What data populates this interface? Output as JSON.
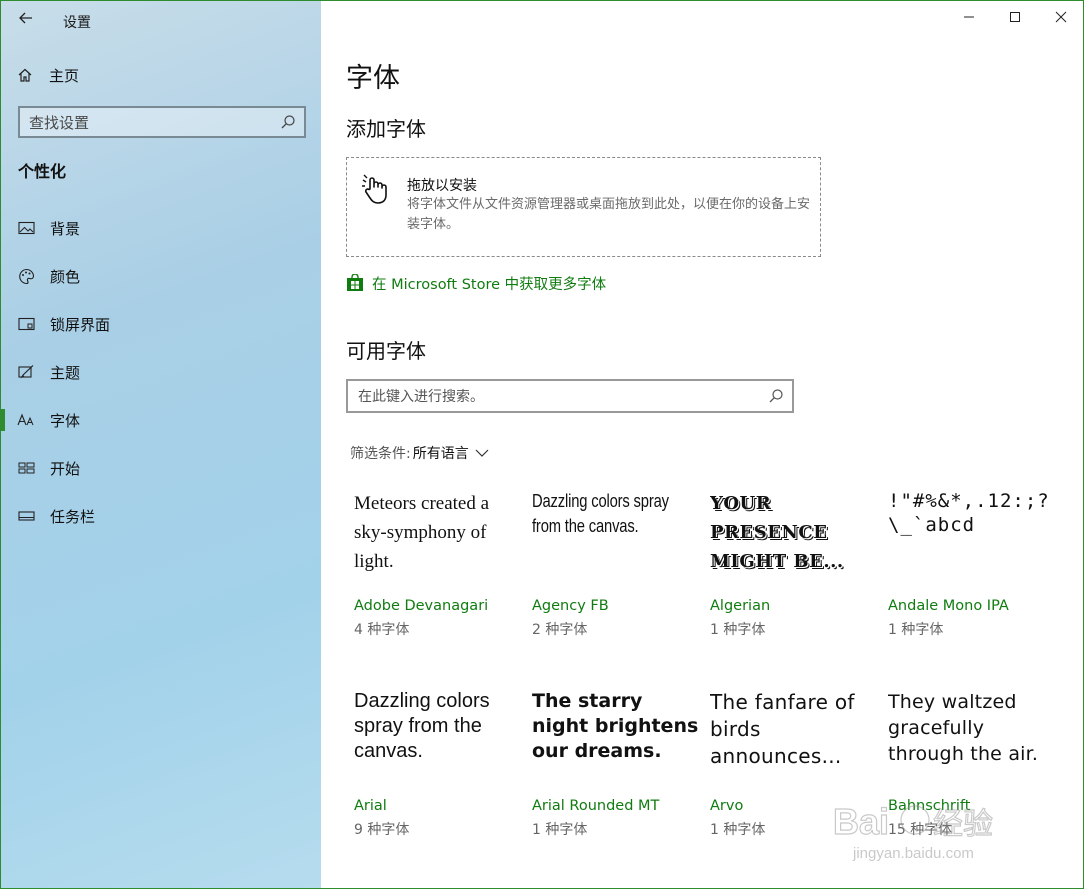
{
  "window": {
    "title": "设置"
  },
  "sidebar": {
    "home_label": "主页",
    "search_placeholder": "查找设置",
    "section_title": "个性化",
    "items": [
      {
        "label": "背景",
        "icon": "picture-icon"
      },
      {
        "label": "颜色",
        "icon": "palette-icon"
      },
      {
        "label": "锁屏界面",
        "icon": "lock-screen-icon"
      },
      {
        "label": "主题",
        "icon": "theme-brush-icon"
      },
      {
        "label": "字体",
        "icon": "font-icon",
        "active": true
      },
      {
        "label": "开始",
        "icon": "start-icon"
      },
      {
        "label": "任务栏",
        "icon": "taskbar-icon"
      }
    ]
  },
  "main": {
    "page_title": "字体",
    "add_heading": "添加字体",
    "drop_zone": {
      "title": "拖放以安装",
      "description": "将字体文件从文件资源管理器或桌面拖放到此处，以便在你的设备上安装字体。"
    },
    "store_link": "在 Microsoft Store 中获取更多字体",
    "available_heading": "可用字体",
    "search_placeholder": "在此键入进行搜索。",
    "filter_label": "筛选条件:",
    "filter_value": "所有语言",
    "fonts": [
      {
        "preview": "Meteors created a sky-symphony of light.",
        "name": "Adobe Devanagari",
        "count": "4 种字体"
      },
      {
        "preview": "Dazzling colors spray from the canvas.",
        "name": "Agency FB",
        "count": "2 种字体"
      },
      {
        "preview": "YOUR PRESENCE MIGHT BE...",
        "name": "Algerian",
        "count": "1 种字体"
      },
      {
        "preview": "!\"#%&*,.12:;?\\_`abcd",
        "name": "Andale Mono IPA",
        "count": "1 种字体"
      },
      {
        "preview": "Dazzling colors spray from the canvas.",
        "name": "Arial",
        "count": "9 种字体"
      },
      {
        "preview": "The starry night brightens our dreams.",
        "name": "Arial Rounded MT",
        "count": "1 种字体"
      },
      {
        "preview": "The fanfare of birds announces...",
        "name": "Arvo",
        "count": "1 种字体"
      },
      {
        "preview": "They waltzed gracefully through the air.",
        "name": "Bahnschrift",
        "count": "15 种字体"
      }
    ]
  },
  "watermark": {
    "text": "Baidu经验",
    "url_text": "jingyan.baidu.com"
  },
  "colors": {
    "accent": "#107c10",
    "active_bar": "#2e8b2e",
    "border": "#2e8b2e"
  }
}
